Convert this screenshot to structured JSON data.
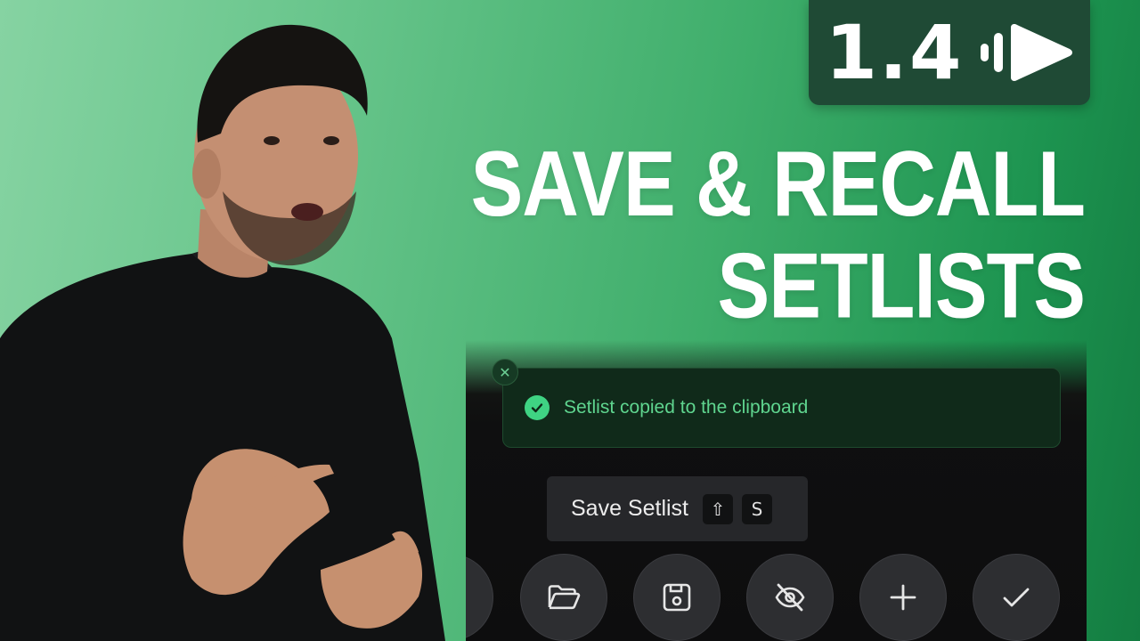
{
  "badge": {
    "version": "1.4",
    "logo_icon": "play-bars-logo-icon"
  },
  "headline": {
    "line1": "SAVE & RECALL",
    "line2": "SETLISTS"
  },
  "toast": {
    "message": "Setlist copied to the clipboard",
    "close_icon": "close-icon",
    "status_icon": "check-circle-icon"
  },
  "tooltip": {
    "label": "Save Setlist",
    "keys": [
      "⇧",
      "S"
    ]
  },
  "toolbar": {
    "buttons": [
      {
        "icon": "partial-button-icon"
      },
      {
        "icon": "folder-open-icon"
      },
      {
        "icon": "save-icon"
      },
      {
        "icon": "eye-off-icon"
      },
      {
        "icon": "plus-icon"
      },
      {
        "icon": "check-icon"
      }
    ]
  },
  "colors": {
    "bg_green": "#3fae6b",
    "badge_bg": "#1f4a35",
    "panel_bg": "#0d0d0e",
    "toast_text": "#5fd58f",
    "button_bg": "#2d2e31"
  }
}
